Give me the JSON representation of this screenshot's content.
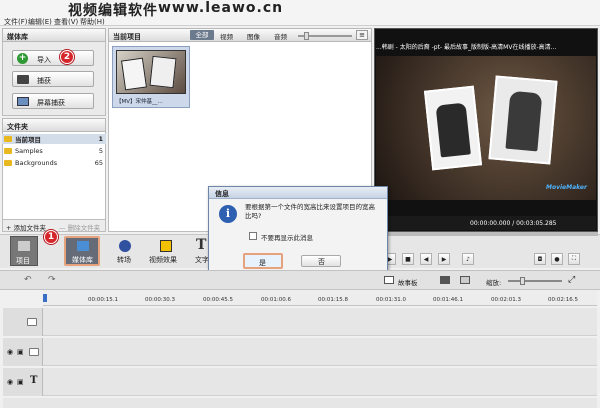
{
  "header": {
    "banner": "视频编辑软件",
    "url": "www.leawo.cn"
  },
  "menu": [
    "文件(F)",
    "编辑(E)",
    "查看(V)",
    "帮助(H)"
  ],
  "media_library": {
    "title": "媒体库",
    "import": "导入",
    "capture": "捕获",
    "screen_capture": "屏幕捕获"
  },
  "folders": {
    "title": "文件夹",
    "items": [
      {
        "name": "当前项目",
        "count": "1"
      },
      {
        "name": "Samples",
        "count": "5"
      },
      {
        "name": "Backgrounds",
        "count": "65"
      }
    ],
    "add": "添加文件夹",
    "remove": "删除文件夹"
  },
  "current_project": {
    "title": "当前项目",
    "tabs": [
      "全部",
      "视频",
      "图像",
      "音频"
    ],
    "clip_label": "【MV】宋仲基__..."
  },
  "preview": {
    "title": "...韩剧 - 太阳的后裔 -pt- 最后故事_版制版-高清MV在线播放-高清...",
    "time": "00:00:00.000 / 00:03:05.285",
    "watermark": "MovieMaker"
  },
  "modes": {
    "project": "项目",
    "library": "媒体库",
    "transition": "转场",
    "video_effects": "视频效果",
    "text": "文字"
  },
  "dialog": {
    "title": "信息",
    "message": "要根据第一个文件的宽高比来设置项目的宽高比吗?",
    "checkbox": "不要再显示此消息",
    "yes": "是",
    "no": "否"
  },
  "timeline": {
    "storyboard": "故事板",
    "zoom": "缩放:",
    "ticks": [
      "00:00:15.1",
      "00:00:30.3",
      "00:00:45.5",
      "00:01:00.6",
      "00:01:15.8",
      "00:01:31.0",
      "00:01:46.1",
      "00:02:01.3",
      "00:02:16.5"
    ]
  },
  "callouts": {
    "one": "1",
    "two": "2"
  },
  "colors": {
    "accent": "#d6262b",
    "dialog_title": "#3c6ea5",
    "highlight": "#e6a27c"
  }
}
